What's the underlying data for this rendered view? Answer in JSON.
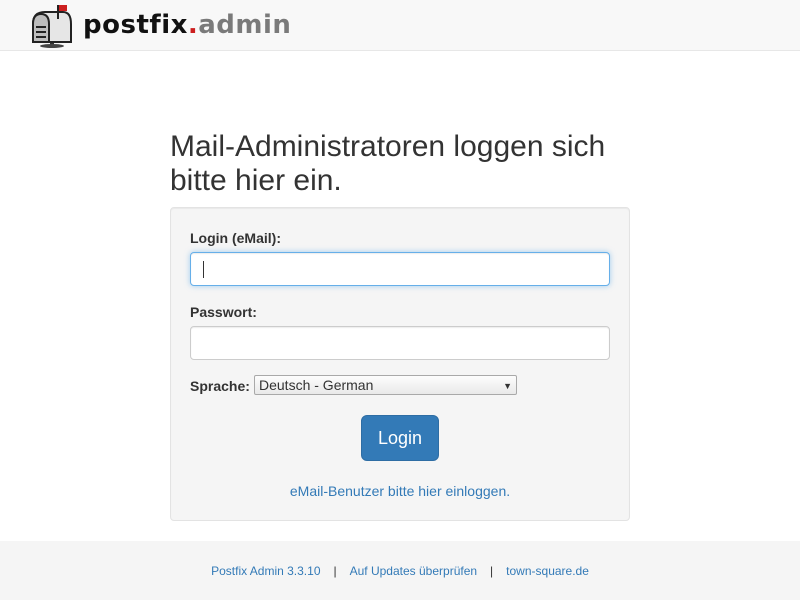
{
  "header": {
    "brand": {
      "postfix": "postfix",
      "dot": ".",
      "admin": "admin"
    },
    "logo_icon": "mailbox-icon"
  },
  "main": {
    "title": "Mail-Administratoren loggen sich bitte hier ein.",
    "form": {
      "login_label": "Login (eMail):",
      "login_value": "",
      "password_label": "Passwort:",
      "password_value": "",
      "language_label": "Sprache:",
      "language_selected": "Deutsch - German",
      "login_button": "Login",
      "user_login_link": "eMail-Benutzer bitte hier einloggen."
    }
  },
  "footer": {
    "version": "Postfix Admin 3.3.10",
    "separator": "|",
    "updates": "Auf Updates überprüfen",
    "site": "town-square.de"
  },
  "colors": {
    "accent": "#337ab7",
    "brand_dot": "#cc1f1f",
    "brand_admin": "#7a7a7a",
    "panel_bg": "#f5f5f5",
    "header_bg": "#f8f8f8"
  }
}
